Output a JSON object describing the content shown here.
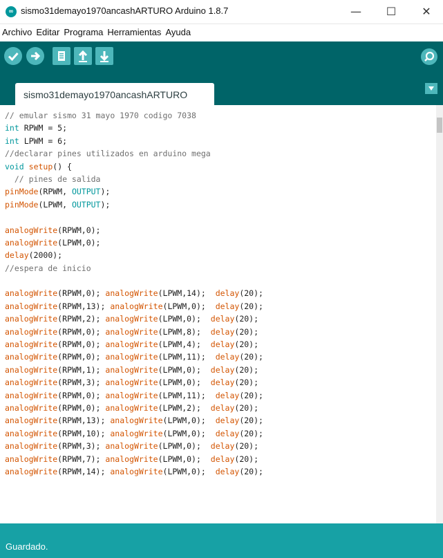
{
  "window": {
    "title": "sismo31demayo1970ancashARTURO Arduino 1.8.7",
    "app_icon_text": "∞",
    "minimize": "—",
    "maximize": "☐",
    "close": "✕"
  },
  "menu": [
    "Archivo",
    "Editar",
    "Programa",
    "Herramientas",
    "Ayuda"
  ],
  "toolbar": {
    "buttons": [
      "verify-icon",
      "upload-icon",
      "new-icon",
      "open-icon",
      "save-icon"
    ],
    "serial_monitor": "serial-monitor-icon",
    "color": "#006468",
    "button_color": "#4db7bb"
  },
  "tab": {
    "label": "sismo31demayo1970ancashARTURO"
  },
  "code_lines": [
    [
      [
        "// emular sismo 31 mayo 1970 codigo 7038",
        "comment"
      ]
    ],
    [
      [
        "int",
        "kw"
      ],
      [
        " RPWM = 5;",
        "plain"
      ]
    ],
    [
      [
        "int",
        "kw"
      ],
      [
        " LPWM = 6;",
        "plain"
      ]
    ],
    [
      [
        "//declarar pines utilizados en arduino mega",
        "comment"
      ]
    ],
    [
      [
        "void",
        "kw"
      ],
      [
        " ",
        "plain"
      ],
      [
        "setup",
        "fn"
      ],
      [
        "() {",
        "plain"
      ]
    ],
    [
      [
        "  // pines de salida",
        "comment"
      ]
    ],
    [
      [
        "pinMode",
        "fn"
      ],
      [
        "(RPWM, ",
        "plain"
      ],
      [
        "OUTPUT",
        "const"
      ],
      [
        ");",
        "plain"
      ]
    ],
    [
      [
        "pinMode",
        "fn"
      ],
      [
        "(LPWM, ",
        "plain"
      ],
      [
        "OUTPUT",
        "const"
      ],
      [
        ");",
        "plain"
      ]
    ],
    [],
    [
      [
        "analogWrite",
        "fn"
      ],
      [
        "(RPWM,0);",
        "plain"
      ]
    ],
    [
      [
        "analogWrite",
        "fn"
      ],
      [
        "(LPWM,0);",
        "plain"
      ]
    ],
    [
      [
        "delay",
        "fn"
      ],
      [
        "(2000);",
        "plain"
      ]
    ],
    [
      [
        "//espera de inicio",
        "comment"
      ]
    ],
    [],
    [
      [
        "analogWrite",
        "fn"
      ],
      [
        "(RPWM,0); ",
        "plain"
      ],
      [
        "analogWrite",
        "fn"
      ],
      [
        "(LPWM,14);  ",
        "plain"
      ],
      [
        "delay",
        "fn"
      ],
      [
        "(20);",
        "plain"
      ]
    ],
    [
      [
        "analogWrite",
        "fn"
      ],
      [
        "(RPWM,13); ",
        "plain"
      ],
      [
        "analogWrite",
        "fn"
      ],
      [
        "(LPWM,0);  ",
        "plain"
      ],
      [
        "delay",
        "fn"
      ],
      [
        "(20);",
        "plain"
      ]
    ],
    [
      [
        "analogWrite",
        "fn"
      ],
      [
        "(RPWM,2); ",
        "plain"
      ],
      [
        "analogWrite",
        "fn"
      ],
      [
        "(LPWM,0);  ",
        "plain"
      ],
      [
        "delay",
        "fn"
      ],
      [
        "(20);",
        "plain"
      ]
    ],
    [
      [
        "analogWrite",
        "fn"
      ],
      [
        "(RPWM,0); ",
        "plain"
      ],
      [
        "analogWrite",
        "fn"
      ],
      [
        "(LPWM,8);  ",
        "plain"
      ],
      [
        "delay",
        "fn"
      ],
      [
        "(20);",
        "plain"
      ]
    ],
    [
      [
        "analogWrite",
        "fn"
      ],
      [
        "(RPWM,0); ",
        "plain"
      ],
      [
        "analogWrite",
        "fn"
      ],
      [
        "(LPWM,4);  ",
        "plain"
      ],
      [
        "delay",
        "fn"
      ],
      [
        "(20);",
        "plain"
      ]
    ],
    [
      [
        "analogWrite",
        "fn"
      ],
      [
        "(RPWM,0); ",
        "plain"
      ],
      [
        "analogWrite",
        "fn"
      ],
      [
        "(LPWM,11);  ",
        "plain"
      ],
      [
        "delay",
        "fn"
      ],
      [
        "(20);",
        "plain"
      ]
    ],
    [
      [
        "analogWrite",
        "fn"
      ],
      [
        "(RPWM,1); ",
        "plain"
      ],
      [
        "analogWrite",
        "fn"
      ],
      [
        "(LPWM,0);  ",
        "plain"
      ],
      [
        "delay",
        "fn"
      ],
      [
        "(20);",
        "plain"
      ]
    ],
    [
      [
        "analogWrite",
        "fn"
      ],
      [
        "(RPWM,3); ",
        "plain"
      ],
      [
        "analogWrite",
        "fn"
      ],
      [
        "(LPWM,0);  ",
        "plain"
      ],
      [
        "delay",
        "fn"
      ],
      [
        "(20);",
        "plain"
      ]
    ],
    [
      [
        "analogWrite",
        "fn"
      ],
      [
        "(RPWM,0); ",
        "plain"
      ],
      [
        "analogWrite",
        "fn"
      ],
      [
        "(LPWM,11);  ",
        "plain"
      ],
      [
        "delay",
        "fn"
      ],
      [
        "(20);",
        "plain"
      ]
    ],
    [
      [
        "analogWrite",
        "fn"
      ],
      [
        "(RPWM,0); ",
        "plain"
      ],
      [
        "analogWrite",
        "fn"
      ],
      [
        "(LPWM,2);  ",
        "plain"
      ],
      [
        "delay",
        "fn"
      ],
      [
        "(20);",
        "plain"
      ]
    ],
    [
      [
        "analogWrite",
        "fn"
      ],
      [
        "(RPWM,13); ",
        "plain"
      ],
      [
        "analogWrite",
        "fn"
      ],
      [
        "(LPWM,0);  ",
        "plain"
      ],
      [
        "delay",
        "fn"
      ],
      [
        "(20);",
        "plain"
      ]
    ],
    [
      [
        "analogWrite",
        "fn"
      ],
      [
        "(RPWM,10); ",
        "plain"
      ],
      [
        "analogWrite",
        "fn"
      ],
      [
        "(LPWM,0);  ",
        "plain"
      ],
      [
        "delay",
        "fn"
      ],
      [
        "(20);",
        "plain"
      ]
    ],
    [
      [
        "analogWrite",
        "fn"
      ],
      [
        "(RPWM,3); ",
        "plain"
      ],
      [
        "analogWrite",
        "fn"
      ],
      [
        "(LPWM,0);  ",
        "plain"
      ],
      [
        "delay",
        "fn"
      ],
      [
        "(20);",
        "plain"
      ]
    ],
    [
      [
        "analogWrite",
        "fn"
      ],
      [
        "(RPWM,7); ",
        "plain"
      ],
      [
        "analogWrite",
        "fn"
      ],
      [
        "(LPWM,0);  ",
        "plain"
      ],
      [
        "delay",
        "fn"
      ],
      [
        "(20);",
        "plain"
      ]
    ],
    [
      [
        "analogWrite",
        "fn"
      ],
      [
        "(RPWM,14); ",
        "plain"
      ],
      [
        "analogWrite",
        "fn"
      ],
      [
        "(LPWM,0);  ",
        "plain"
      ],
      [
        "delay",
        "fn"
      ],
      [
        "(20);",
        "plain"
      ]
    ]
  ],
  "status": {
    "text": "Guardado."
  }
}
